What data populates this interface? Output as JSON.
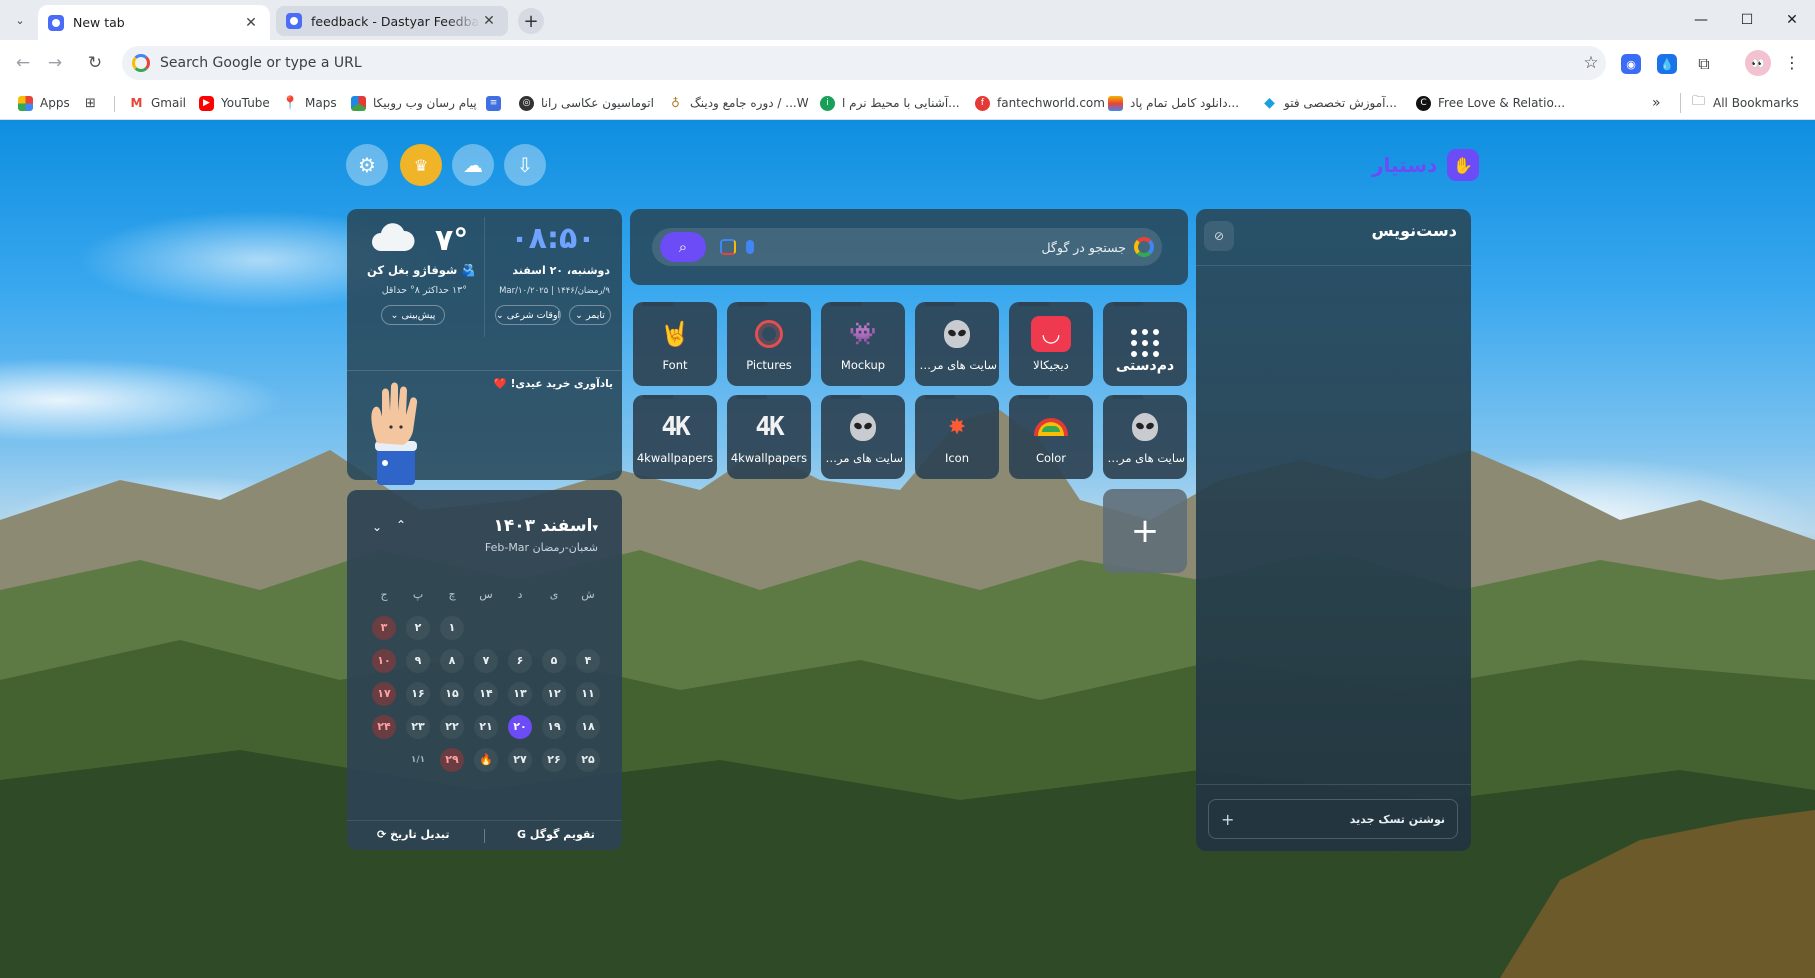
{
  "browser": {
    "tabs": [
      {
        "title": "New tab",
        "active": true
      },
      {
        "title": "feedback - Dastyar Feedback C",
        "active": false
      }
    ],
    "omnibox_placeholder": "Search Google or type a URL",
    "bookmarks": [
      {
        "label": "Apps",
        "icon": "apps-grid-icon"
      },
      {
        "label": "Gmail",
        "icon": "gmail-icon"
      },
      {
        "label": "YouTube",
        "icon": "youtube-icon"
      },
      {
        "label": "Maps",
        "icon": "maps-icon"
      },
      {
        "label": "پیام رسان وب روبیکا",
        "icon": "rubika-icon"
      },
      {
        "label": "اتوماسیون عکاسی رانا",
        "icon": "globe-icon"
      },
      {
        "label": "دوره جامع ودینگ / ...W",
        "icon": "wedding-icon"
      },
      {
        "label": "آشنایی با محیط نرم ا...",
        "icon": "green-circle-icon"
      },
      {
        "label": "fantechworld.com",
        "icon": "fantech-icon"
      },
      {
        "label": "دانلود کامل تمام پاد...",
        "icon": "book-icon"
      },
      {
        "label": "آموزش تخصصی فتو...",
        "icon": "diamond-icon"
      },
      {
        "label": "Free Love & Relatio...",
        "icon": "c-icon"
      }
    ],
    "all_bookmarks_label": "All Bookmarks"
  },
  "app": {
    "brand": "دستیار"
  },
  "weather": {
    "temp": "۷°",
    "location": "شوفاژو بغل کن 🫂",
    "minmax": "۱۳° حداکثر  ۸° حداقل",
    "forecast_btn": "پیش‌بینی"
  },
  "clock": {
    "time": "۰۸:۵۰",
    "date": "دوشنبه، ۲۰ اسفند",
    "sub_date": "۹/رمضان/۱۴۴۶ | ۲۰۲۵/Mar/۱۰",
    "timer_btn": "تایمر",
    "prayer_btn": "اوقات شرعی"
  },
  "reminder": {
    "text": "یادآوری خرید عیدی! ❤️"
  },
  "search": {
    "placeholder": "جستجو در گوگل"
  },
  "shortcuts": [
    {
      "label": "دم‌دستی",
      "icon": "grid-dots-icon"
    },
    {
      "label": "دیجیکالا",
      "icon": "digikala-icon"
    },
    {
      "label": "سایت های مرب...",
      "icon": "alien-icon"
    },
    {
      "label": "Mockup",
      "icon": "space-invader-icon"
    },
    {
      "label": "Pictures",
      "icon": "ferris-wheel-icon"
    },
    {
      "label": "Font",
      "icon": "rock-hand-icon"
    },
    {
      "label": "سایت های مرب...",
      "icon": "alien-icon"
    },
    {
      "label": "Color",
      "icon": "rainbow-icon"
    },
    {
      "label": "Icon",
      "icon": "spark-icon"
    },
    {
      "label": "سایت های مرب...",
      "icon": "alien-icon"
    },
    {
      "label": "4kwallpapers",
      "icon": "4k-icon"
    },
    {
      "label": "4kwallpapers",
      "icon": "4k-icon"
    }
  ],
  "calendar": {
    "month_title": "اسفند ۱۴۰۳",
    "sub": "شعبان-رمضان   Feb-Mar",
    "weekdays": [
      "ش",
      "ی",
      "د",
      "س",
      "چ",
      "پ",
      "ج"
    ],
    "weeks": [
      [
        "",
        "",
        "",
        "",
        "۱",
        "۲",
        "۳"
      ],
      [
        "۴",
        "۵",
        "۶",
        "۷",
        "۸",
        "۹",
        "۱۰"
      ],
      [
        "۱۱",
        "۱۲",
        "۱۳",
        "۱۴",
        "۱۵",
        "۱۶",
        "۱۷"
      ],
      [
        "۱۸",
        "۱۹",
        "۲۰",
        "۲۱",
        "۲۲",
        "۲۳",
        "۲۴"
      ],
      [
        "۲۵",
        "۲۶",
        "۲۷",
        "🔥",
        "۲۹",
        "۱/۱",
        ""
      ]
    ],
    "today": "۲۰",
    "google_cal_btn": "تقویم گوگل",
    "convert_btn": "تبدیل تاریخ"
  },
  "notes": {
    "title": "دست‌نویس",
    "new_task_placeholder": "نوشتن تسک جدید"
  },
  "colors": {
    "accent": "#6b4cf6",
    "clock": "#6fa3ff",
    "friday": "#ff9f9f"
  }
}
